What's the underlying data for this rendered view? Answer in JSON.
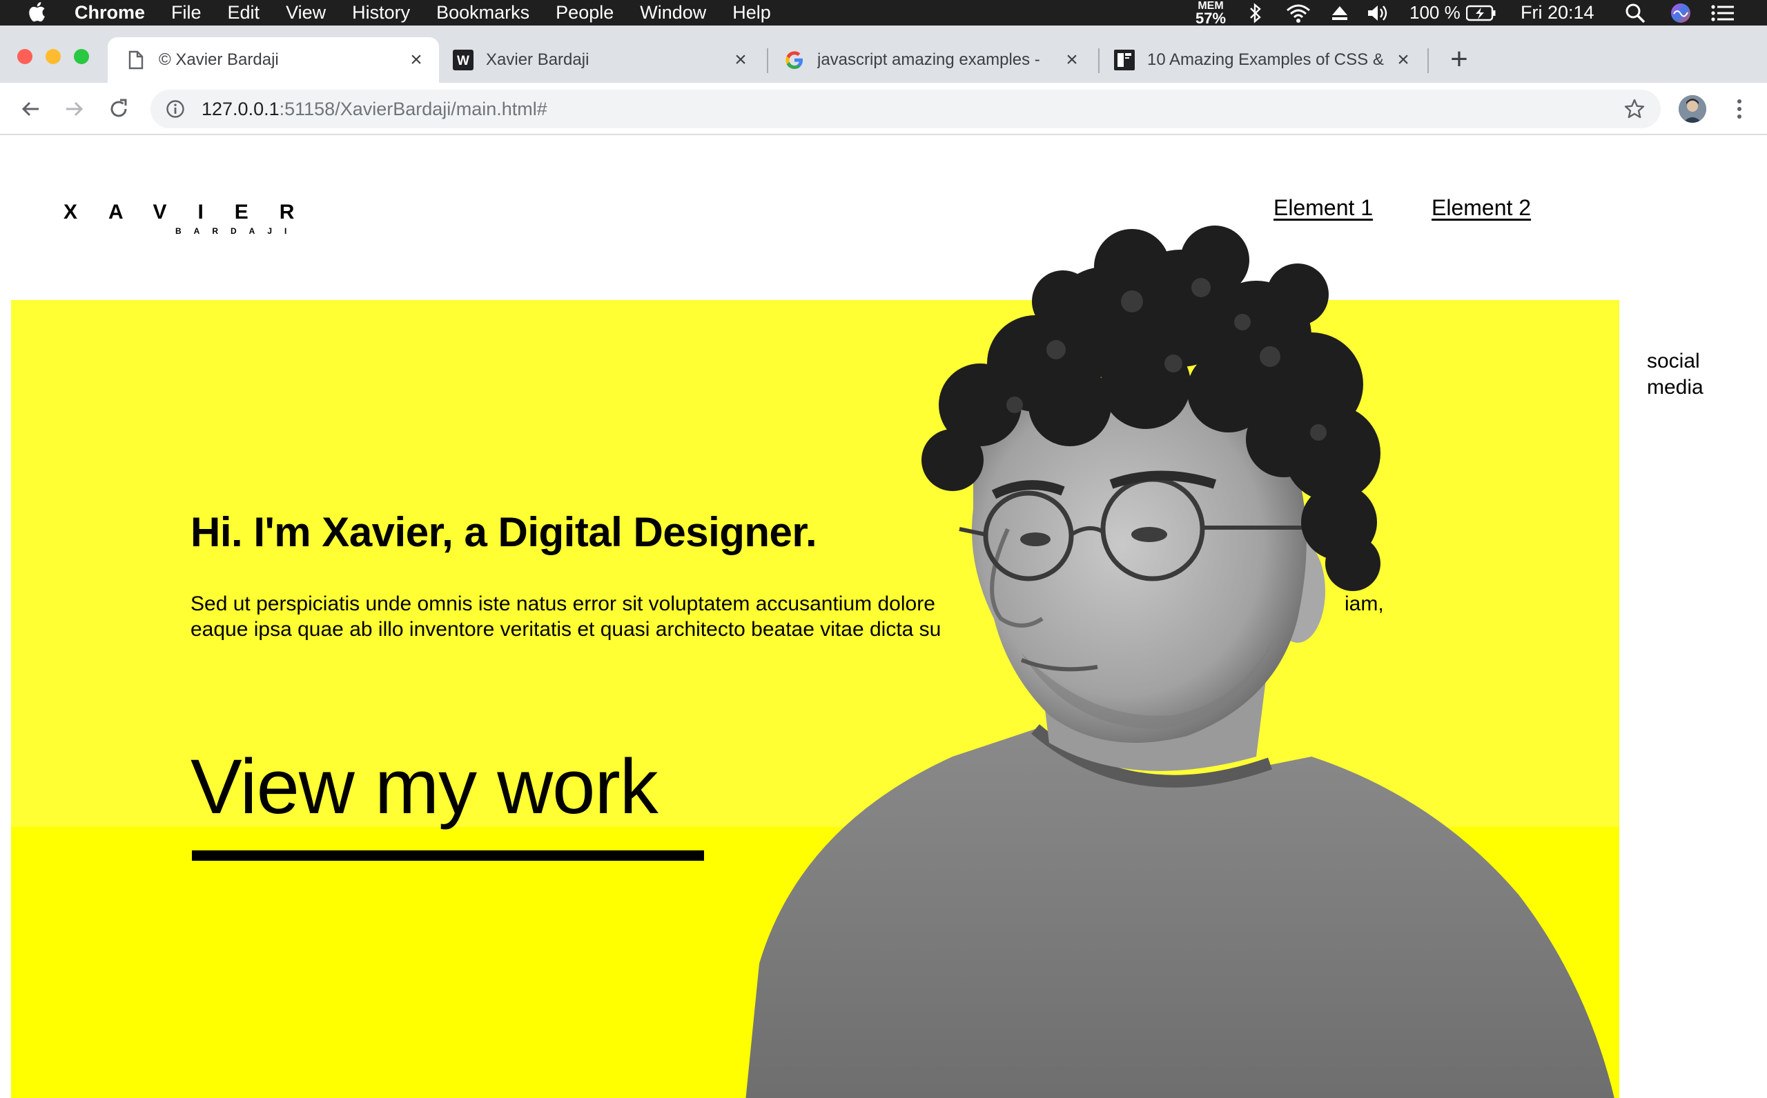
{
  "menubar": {
    "app_name": "Chrome",
    "menus": [
      "File",
      "Edit",
      "View",
      "History",
      "Bookmarks",
      "People",
      "Window",
      "Help"
    ],
    "mem_label": "MEM",
    "mem_value": "57%",
    "battery": "100 %",
    "clock": "Fri 20:14"
  },
  "tabs": [
    {
      "title": "© Xavier Bardaji",
      "icon": "page-icon"
    },
    {
      "title": "Xavier Bardaji",
      "icon": "w-logo-icon"
    },
    {
      "title": "javascript amazing examples - ",
      "icon": "google-icon"
    },
    {
      "title": "10 Amazing Examples of CSS & ",
      "icon": "book-icon"
    }
  ],
  "address": {
    "host": "127.0.0.1",
    "path": ":51158/XavierBardaji/main.html#"
  },
  "site": {
    "logo_big": "XAVIER",
    "logo_small": "BARDAJI",
    "nav": [
      "Element 1",
      "Element 2"
    ],
    "social": "social media",
    "headline": "Hi. I'm Xavier, a Digital Designer.",
    "body_line1": "Sed ut perspiciatis unde omnis iste natus error sit voluptatem accusantium dolore",
    "body_line1_end": "iam,",
    "body_line2": "eaque ipsa quae ab illo inventore veritatis et quasi architecto beatae vitae dicta su",
    "cta": "View my work"
  },
  "colors": {
    "hero_yellow": "#ffff33",
    "hero_yellow_lower": "#ffff00",
    "tabstrip": "#dee1e6",
    "menubar": "#1f1f1f"
  }
}
